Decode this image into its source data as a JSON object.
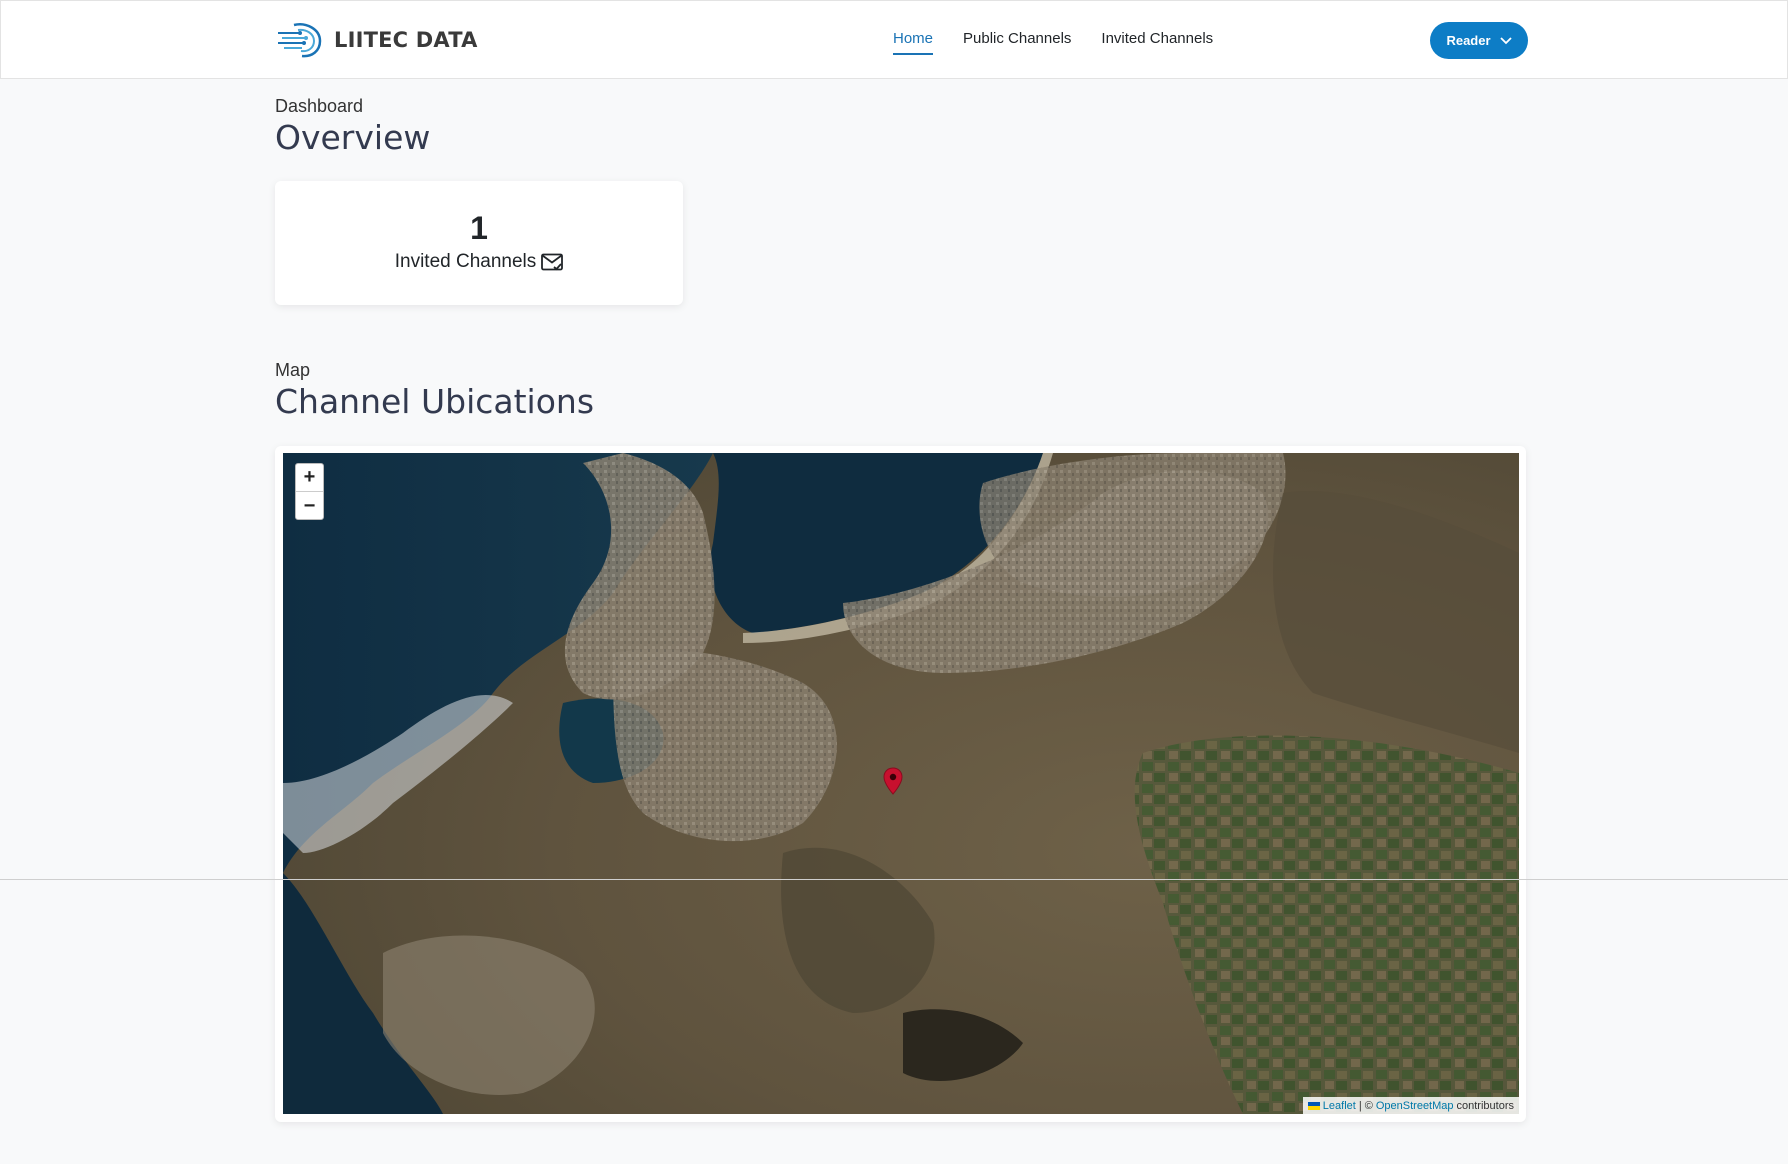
{
  "brand": {
    "name": "LIITEC DATA"
  },
  "nav": {
    "links": [
      {
        "label": "Home",
        "active": true
      },
      {
        "label": "Public Channels",
        "active": false
      },
      {
        "label": "Invited Channels",
        "active": false
      }
    ],
    "user_button": "Reader"
  },
  "dashboard": {
    "subtitle": "Dashboard",
    "title": "Overview",
    "stat": {
      "value": "1",
      "label": "Invited Channels",
      "icon": "envelope-check-icon"
    }
  },
  "map_section": {
    "subtitle": "Map",
    "title": "Channel Ubications",
    "zoom_in": "+",
    "zoom_out": "−",
    "attribution": {
      "leaflet": "Leaflet",
      "separator": "| ©",
      "osm": "OpenStreetMap",
      "suffix": "contributors"
    }
  },
  "colors": {
    "accent": "#0d7dc6",
    "active_link": "#1a73b5",
    "marker": "#c8102e"
  }
}
